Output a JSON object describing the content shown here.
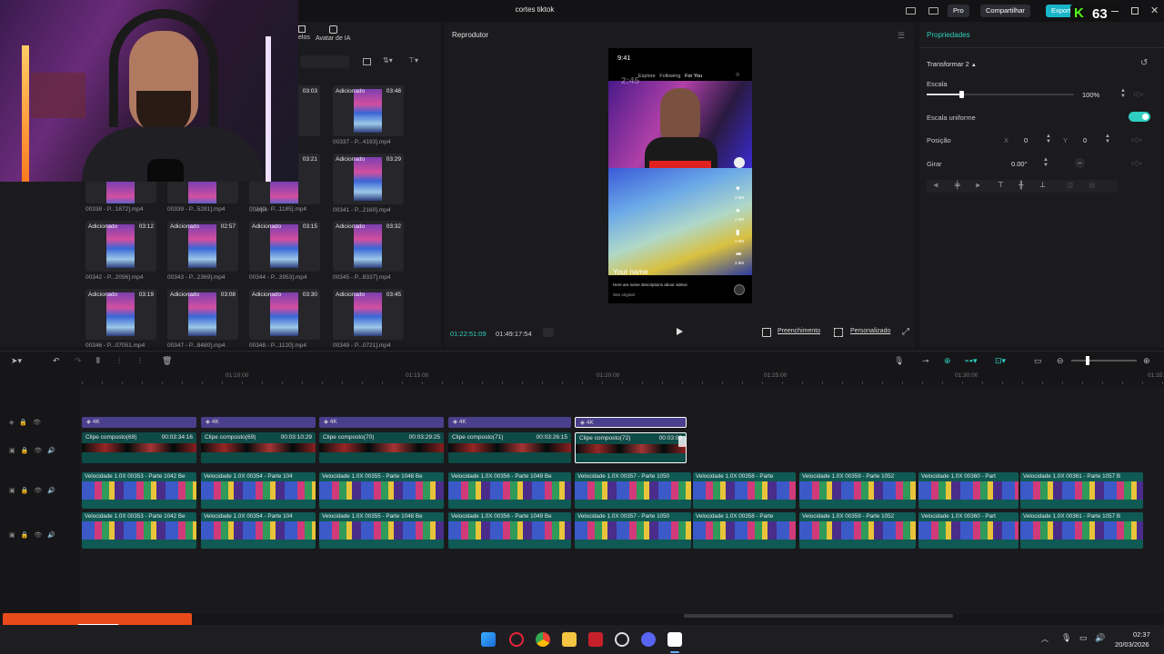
{
  "window": {
    "title": "cortes tiktok",
    "pro": "Pro",
    "share": "Compartilhar",
    "export": "Exportar",
    "score": "63"
  },
  "media": {
    "tab_ai_avatar": "Avatar de IA",
    "tab_models": "elos",
    "clips": [
      {
        "tag": "",
        "dur": "03:03",
        "cap": "....mp4"
      },
      {
        "tag": "Adicionado",
        "dur": "03:48",
        "cap": "00337 - P...4193].mp4"
      },
      {
        "tag": "",
        "dur": "03:21",
        "cap": "....mp4"
      },
      {
        "tag": "Adicionado",
        "dur": "03:29",
        "cap": "00341 - P...2160].mp4"
      },
      {
        "tag": "",
        "dur": "",
        "cap": "00338 - P...1872].mp4"
      },
      {
        "tag": "",
        "dur": "",
        "cap": "00339 - P...5281].mp4"
      },
      {
        "tag": "",
        "dur": "",
        "cap": "00340 - P...1185].mp4"
      },
      {
        "tag": "Adicionado",
        "dur": "03:12",
        "cap": "00342 - P...2096].mp4"
      },
      {
        "tag": "Adicionado",
        "dur": "02:57",
        "cap": "00343 - P...2369].mp4"
      },
      {
        "tag": "Adicionado",
        "dur": "03:15",
        "cap": "00344 - P...3953].mp4"
      },
      {
        "tag": "Adicionado",
        "dur": "03:32",
        "cap": "00345 - P...8337].mp4"
      },
      {
        "tag": "Adicionado",
        "dur": "03:19",
        "cap": "00346 - P...07051.mp4"
      },
      {
        "tag": "Adicionado",
        "dur": "03:08",
        "cap": "00347 - P...8480].mp4"
      },
      {
        "tag": "Adicionado",
        "dur": "03:30",
        "cap": "00348 - P...1120].mp4"
      },
      {
        "tag": "Adicionado",
        "dur": "03:45",
        "cap": "00349 - P...0721].mp4"
      }
    ]
  },
  "player": {
    "title": "Reprodutor",
    "time_current": "01:22:51:09",
    "time_total": "01:49:17:54",
    "fill_btn": "Preenchimento",
    "custom_btn": "Personalizado",
    "phone": {
      "status_time": "9:41",
      "nav_explore": "Explore",
      "nav_following": "Following",
      "nav_foryou": "For You",
      "username": "Your name",
      "desc": "Here are some descriptions about videos",
      "see_original": "See original",
      "likes": "2.8M",
      "comments": "2.8M",
      "saves": "2.8M",
      "shares": "2.8M",
      "top_text": "2:45"
    }
  },
  "props": {
    "title": "Propriedades",
    "section": "Transformar 2",
    "scale_label": "Escala",
    "scale_value": "100%",
    "scale_fraction": 1.0,
    "uniform_label": "Escala uniforme",
    "uniform_on": true,
    "pos_label": "Posição",
    "pos_x_label": "X",
    "pos_x": "0",
    "pos_y_label": "Y",
    "pos_y": "0",
    "rotate_label": "Girar",
    "rotate_value": "0.00°",
    "accent": "#2ecfc0"
  },
  "timeline": {
    "ruler": [
      "01:10:00",
      "01:15:00",
      "01:20:00",
      "01:25:00",
      "01:30:00",
      "01:35:00"
    ],
    "tags": [
      "4K",
      "4K",
      "4K",
      "4K",
      "4K"
    ],
    "compounds": [
      {
        "name": "Clipe composto(69)",
        "dur": "00:03:34:16"
      },
      {
        "name": "Clipe composto(69)",
        "dur": "00:03:10:29"
      },
      {
        "name": "Clipe composto(70)",
        "dur": "00:03:29:25"
      },
      {
        "name": "Clipe composto(71)",
        "dur": "00:03:26:15"
      },
      {
        "name": "Clipe composto(72)",
        "dur": "00:03:08"
      }
    ],
    "vclips_a": [
      "Velocidade 1.0X  00353 - Parte 1042 Be",
      "Velocidade 1.0X  00354 - Parte 104",
      "Velocidade 1.0X  00355 - Parte 1048 Be",
      "Velocidade 1.0X  00356 - Parte 1049 Be",
      "Velocidade 1.0X  00357 - Parte 1050",
      "Velocidade 1.0X  00358 - Parte",
      "Velocidade 1.0X  00359 - Parte 1052",
      "Velocidade 1.0X  00360 - Part",
      "Velocidade 1.0X  00361 - Parte 1057 B"
    ],
    "vclips_b": [
      "Velocidade 1.0X  00353 - Parte 1042 Be",
      "Velocidade 1.0X  00354 - Parte 104",
      "Velocidade 1.0X  00355 - Parte 1048 Be",
      "Velocidade 1.0X  00356 - Parte 1049 Be",
      "Velocidade 1.0X  00357 - Parte 1050",
      "Velocidade 1.0X  00358 - Parte",
      "Velocidade 1.0X  00359 - Parte 1052",
      "Velocidade 1.0X  00360 - Part",
      "Velocidade 1.0X  00361 - Parte 1057 B"
    ]
  },
  "taskbar": {
    "time": "02:37",
    "date": "20/03/2026"
  }
}
